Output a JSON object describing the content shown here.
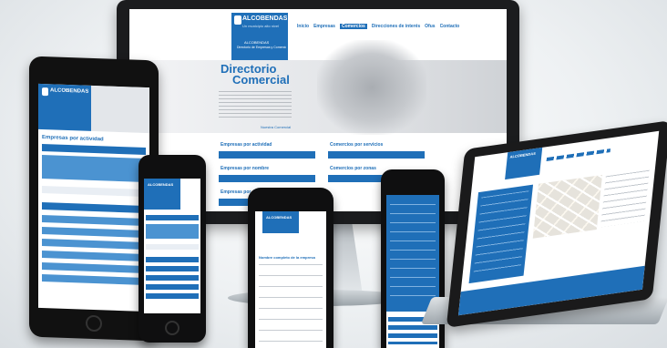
{
  "site": {
    "brand": "ALCOBENDAS",
    "brand_tagline": "Un municipio alto nivel",
    "brand_unit": "ALCOBENDAS",
    "brand_unit_sub": "Directorio de Empresas y Comercios"
  },
  "nav": [
    "Inicio",
    "Empresas",
    "Comercios",
    "Direcciones de interés",
    "Ofus",
    "Contacto"
  ],
  "hero": {
    "title_line1": "Directorio",
    "title_line2": "Comercial",
    "more_link": "Nuestra Comercial"
  },
  "search": {
    "by_activity_label": "Empresas por actividad",
    "by_name_label": "Empresas por nombre",
    "commerce_services_label": "Comercios por servicios",
    "commerce_zone_label": "Comercios por zonas",
    "companies_section_label": "Empresas por actividad"
  },
  "list": {
    "item": "Nombre completo de la empresa"
  },
  "colors": {
    "brand_blue": "#1f6fb8",
    "light_blue": "#4b93d1",
    "bezel": "#111111"
  }
}
